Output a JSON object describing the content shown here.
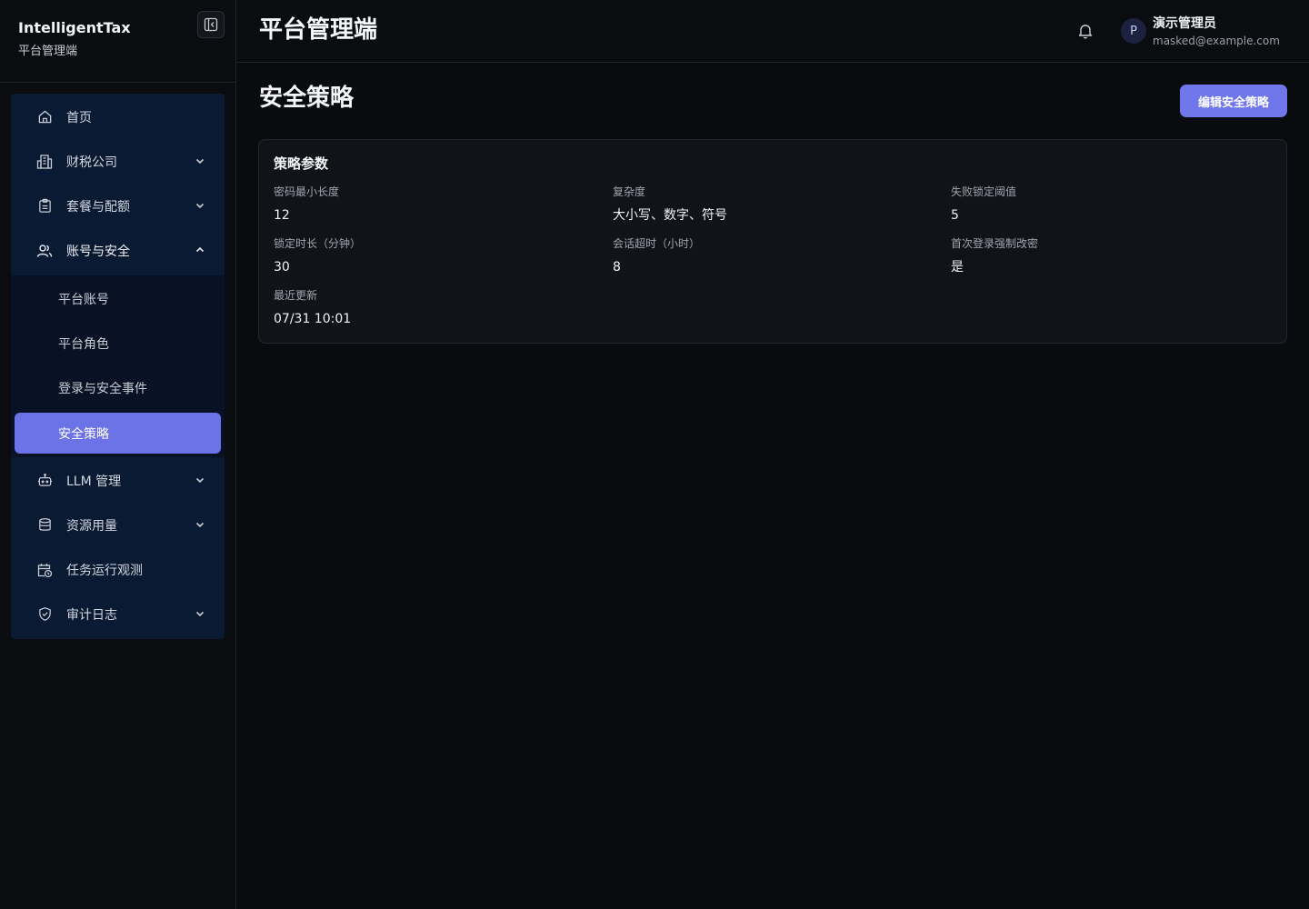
{
  "brand": {
    "name": "IntelligentTax",
    "subtitle": "平台管理端"
  },
  "sidebar": {
    "items": [
      {
        "label": "首页",
        "icon": "home-icon"
      },
      {
        "label": "财税公司",
        "icon": "building-icon"
      },
      {
        "label": "套餐与配额",
        "icon": "clipboard-icon"
      },
      {
        "label": "账号与安全",
        "icon": "users-icon"
      },
      {
        "label": "LLM 管理",
        "icon": "robot-icon"
      },
      {
        "label": "资源用量",
        "icon": "database-icon"
      },
      {
        "label": "任务运行观测",
        "icon": "calendar-clock-icon"
      },
      {
        "label": "审计日志",
        "icon": "shield-check-icon"
      }
    ],
    "sub_items": [
      {
        "label": "平台账号"
      },
      {
        "label": "平台角色"
      },
      {
        "label": "登录与安全事件"
      },
      {
        "label": "安全策略"
      }
    ]
  },
  "header": {
    "title": "平台管理端",
    "user": {
      "initial": "P",
      "name": "演示管理员",
      "email": "masked@example.com"
    }
  },
  "main": {
    "page_title": "安全策略",
    "edit_button": "编辑安全策略",
    "card": {
      "title": "策略参数",
      "fields": [
        {
          "label": "密码最小长度",
          "value": "12"
        },
        {
          "label": "复杂度",
          "value": "大小写、数字、符号"
        },
        {
          "label": "失败锁定阈值",
          "value": "5"
        },
        {
          "label": "锁定时长（分钟）",
          "value": "30"
        },
        {
          "label": "会话超时（小时）",
          "value": "8"
        },
        {
          "label": "首次登录强制改密",
          "value": "是"
        },
        {
          "label": "最近更新",
          "value": "07/31 10:01"
        }
      ]
    }
  },
  "colors": {
    "accent": "#7077ea",
    "sidebar_nav_bg": "#0a1a33",
    "background": "#0a0b0e"
  }
}
